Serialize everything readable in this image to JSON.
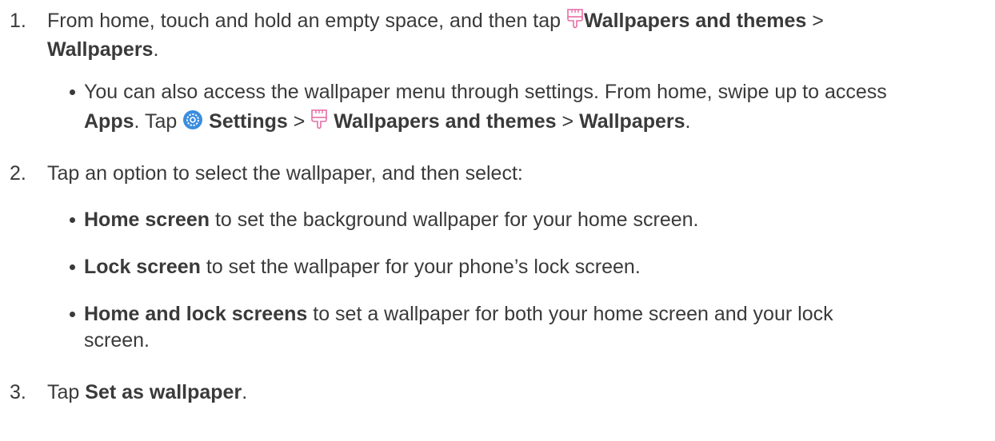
{
  "steps": [
    {
      "number": "1.",
      "line1": {
        "a": "From home, touch and hold an empty space, and then tap ",
        "icon": "paintbrush-icon",
        "b": "Wallpapers and themes",
        "c": " >"
      },
      "line2": {
        "a": "Wallpapers",
        "b": "."
      },
      "bullets": [
        {
          "line1": "You can also access the wallpaper menu through settings. From home, swipe up to access",
          "line2": {
            "a": "Apps",
            "b": ". Tap ",
            "icon1": "settings-gear-icon",
            "c": "Settings",
            "d": " > ",
            "icon2": "paintbrush-icon",
            "e": "Wallpapers and themes",
            "f": " > ",
            "g": "Wallpapers",
            "h": "."
          }
        }
      ]
    },
    {
      "number": "2.",
      "text": "Tap an option to select the wallpaper, and then select:",
      "bullets": [
        {
          "bold": "Home screen",
          "rest": " to set the background wallpaper for your home screen."
        },
        {
          "bold": "Lock screen",
          "rest": " to set the wallpaper for your phone’s lock screen."
        },
        {
          "bold": "Home and lock screens",
          "rest": " to set a wallpaper for both your home screen and your lock",
          "line2": "screen."
        }
      ]
    },
    {
      "number": "3.",
      "a": "Tap ",
      "bold": "Set as wallpaper",
      "b": "."
    }
  ],
  "colors": {
    "text": "#3a3a3a",
    "settings_icon": "#3a8de0",
    "brush_icon": "#e76ea7"
  }
}
